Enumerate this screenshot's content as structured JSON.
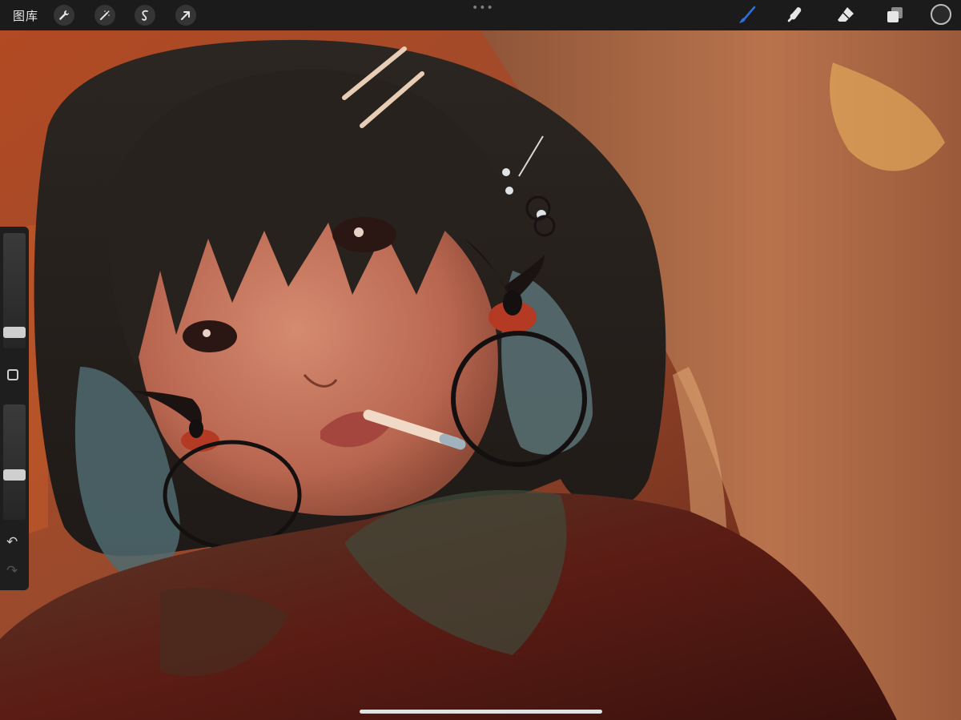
{
  "toolbar": {
    "gallery_label": "图库",
    "left_tools": [
      "wrench-icon",
      "magic-wand-icon",
      "selection-icon",
      "transform-arrow-icon"
    ],
    "handle": "•••",
    "right_tools": [
      "brush-icon",
      "smudge-icon",
      "eraser-icon",
      "layers-icon"
    ],
    "active_tool": "brush-icon",
    "accent": "#2f6fdc"
  },
  "sidebar": {
    "brush_size": 0.2,
    "opacity": 0.4,
    "undo": "↶",
    "redo": "↷"
  },
  "canvas": {
    "subject": "painting"
  }
}
